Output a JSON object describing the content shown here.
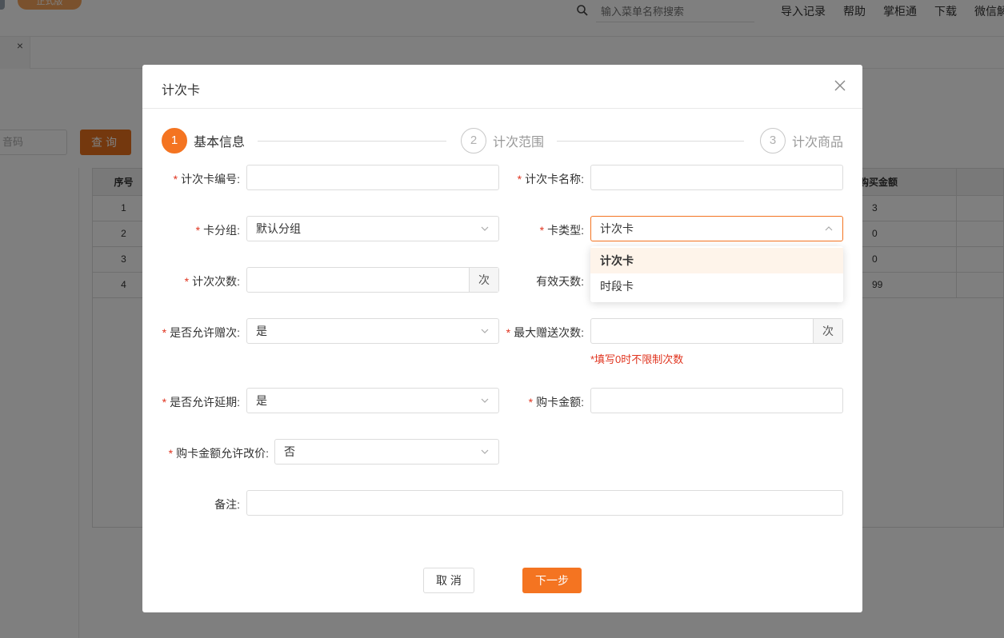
{
  "topbar": {
    "logo_badge": "正式版",
    "search_placeholder": "输入菜单名称搜索",
    "nav": [
      "导入记录",
      "帮助",
      "掌柜通",
      "下载",
      "微信解"
    ]
  },
  "tabbar": {
    "close_glyph": "×"
  },
  "background": {
    "search_placeholder": "音码",
    "query_button": "查询",
    "table": {
      "headers": [
        "序号",
        "购买金额"
      ],
      "rows": [
        {
          "index": "1",
          "amount": "3"
        },
        {
          "index": "2",
          "amount": "0"
        },
        {
          "index": "3",
          "amount": "0"
        },
        {
          "index": "4",
          "amount": "99"
        }
      ]
    }
  },
  "modal": {
    "title": "计次卡",
    "close_icon": "close-icon",
    "steps": [
      {
        "num": "1",
        "label": "基本信息",
        "active": true
      },
      {
        "num": "2",
        "label": "计次范围",
        "active": false
      },
      {
        "num": "3",
        "label": "计次商品",
        "active": false
      }
    ],
    "fields": {
      "card_no": {
        "label": "计次卡编号:",
        "value": ""
      },
      "card_name": {
        "label": "计次卡名称:",
        "value": ""
      },
      "card_group": {
        "label": "卡分组:",
        "value": "默认分组"
      },
      "card_type": {
        "label": "卡类型:",
        "value": "计次卡"
      },
      "count": {
        "label": "计次次数:",
        "value": "",
        "suffix": "次"
      },
      "valid_days": {
        "label": "有效天数:"
      },
      "allow_gift": {
        "label": "是否允许赠次:",
        "value": "是"
      },
      "max_gift": {
        "label": "最大赠送次数:",
        "value": "",
        "suffix": "次",
        "hint": "*填写0时不限制次数"
      },
      "allow_extend": {
        "label": "是否允许延期:",
        "value": "是"
      },
      "price": {
        "label": "购卡金额:",
        "value": ""
      },
      "allow_price_change": {
        "label": "购卡金额允许改价:",
        "value": "否"
      },
      "remark": {
        "label": "备注:",
        "value": ""
      }
    },
    "card_type_options": [
      "计次卡",
      "时段卡"
    ],
    "buttons": {
      "cancel": "取 消",
      "next": "下一步"
    }
  },
  "colors": {
    "accent": "#f47421",
    "required": "#e0341f",
    "overlay": "rgba(0,0,0,0.5)"
  }
}
